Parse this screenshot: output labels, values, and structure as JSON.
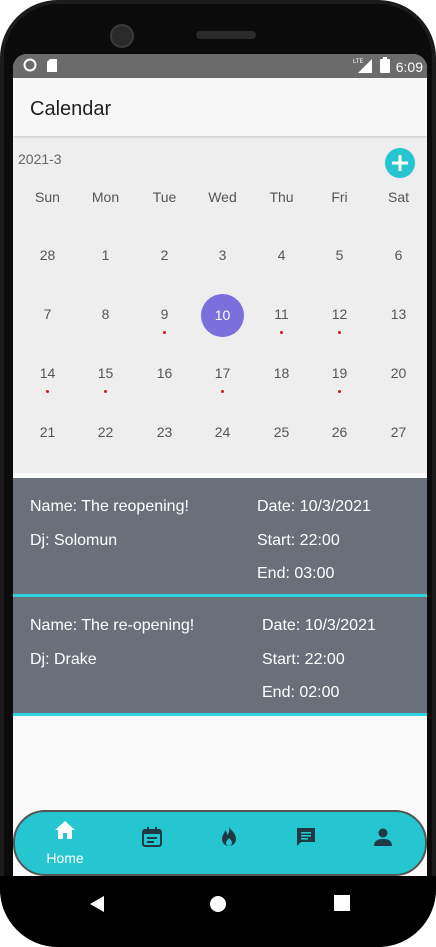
{
  "status_bar": {
    "time": "6:09",
    "network": "LTE"
  },
  "app_bar": {
    "title": "Calendar"
  },
  "calendar": {
    "month_label": "2021-3",
    "add_icon": "plus-icon",
    "weekdays": [
      "Sun",
      "Mon",
      "Tue",
      "Wed",
      "Thu",
      "Fri",
      "Sat"
    ],
    "weeks": [
      [
        "28",
        "1",
        "2",
        "3",
        "4",
        "5",
        "6"
      ],
      [
        "7",
        "8",
        "9",
        "10",
        "11",
        "12",
        "13"
      ],
      [
        "14",
        "15",
        "16",
        "17",
        "18",
        "19",
        "20"
      ],
      [
        "21",
        "22",
        "23",
        "24",
        "25",
        "26",
        "27"
      ]
    ],
    "selected_day": "10",
    "days_with_events": [
      "9",
      "11",
      "12",
      "14",
      "15",
      "17",
      "19"
    ],
    "colors": {
      "selected": "#7b6fdc",
      "event_dot": "#d11a1a",
      "accent": "#26c6d1"
    }
  },
  "events": [
    {
      "name": "Name: The reopening!",
      "dj": "Dj: Solomun",
      "date": "Date: 10/3/2021",
      "start": "Start: 22:00",
      "end": "End: 03:00"
    },
    {
      "name": "Name: The re-opening!",
      "dj": "Dj: Drake",
      "date": "Date: 10/3/2021",
      "start": "Start: 22:00",
      "end": "End: 02:00"
    }
  ],
  "bottom_nav": {
    "items": [
      {
        "icon": "home-icon",
        "label": "Home",
        "active": true
      },
      {
        "icon": "calendar-icon",
        "label": ""
      },
      {
        "icon": "fire-icon",
        "label": ""
      },
      {
        "icon": "chat-icon",
        "label": ""
      },
      {
        "icon": "person-icon",
        "label": ""
      }
    ]
  },
  "system_nav": {
    "icons": [
      "back-icon",
      "home-circle-icon",
      "recents-icon"
    ]
  }
}
